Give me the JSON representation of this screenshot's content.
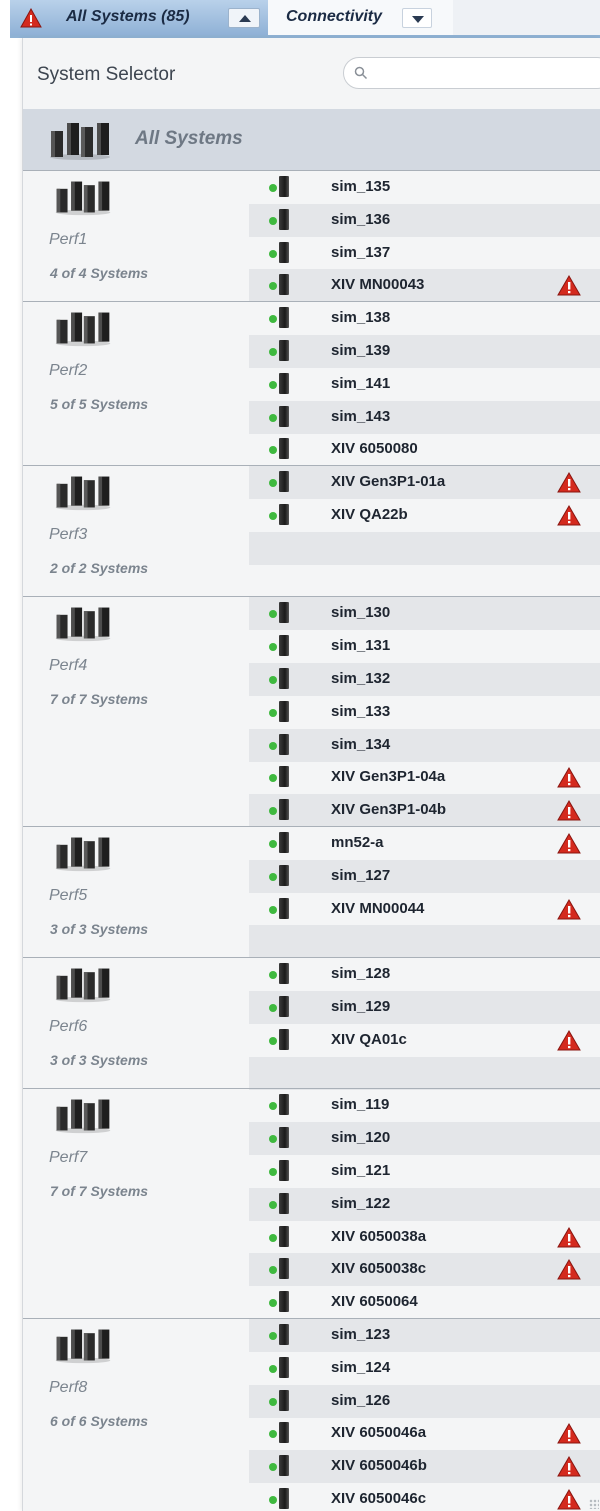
{
  "tabs": {
    "all_systems": {
      "label": "All Systems (85)",
      "alert_icon": "warning-icon",
      "toggle_icon": "chevron-up-icon"
    },
    "connectivity": {
      "label": "Connectivity",
      "toggle_icon": "chevron-down-icon"
    }
  },
  "selector": {
    "title": "System Selector",
    "search_placeholder": "",
    "all_systems_label": "All Systems"
  },
  "colors": {
    "status_online": "#3fb93f",
    "alert_red": "#d42a1e",
    "tab_active": "#a9c4e2",
    "group_label": "#7b848e"
  },
  "groups": [
    {
      "name": "Perf1",
      "count": "4  of 4 Systems",
      "rows": 4,
      "systems": [
        {
          "name": "sim_135",
          "alert": false
        },
        {
          "name": "sim_136",
          "alert": false
        },
        {
          "name": "sim_137",
          "alert": false
        },
        {
          "name": "XIV MN00043",
          "alert": true
        }
      ]
    },
    {
      "name": "Perf2",
      "count": "5  of 5 Systems",
      "rows": 5,
      "systems": [
        {
          "name": "sim_138",
          "alert": false
        },
        {
          "name": "sim_139",
          "alert": false
        },
        {
          "name": "sim_141",
          "alert": false
        },
        {
          "name": "sim_143",
          "alert": false
        },
        {
          "name": "XIV 6050080",
          "alert": false
        }
      ]
    },
    {
      "name": "Perf3",
      "count": "2  of 2 Systems",
      "rows": 4,
      "systems": [
        {
          "name": "XIV Gen3P1-01a",
          "alert": true
        },
        {
          "name": "XIV QA22b",
          "alert": true
        }
      ]
    },
    {
      "name": "Perf4",
      "count": "7  of 7 Systems",
      "rows": 7,
      "systems": [
        {
          "name": "sim_130",
          "alert": false
        },
        {
          "name": "sim_131",
          "alert": false
        },
        {
          "name": "sim_132",
          "alert": false
        },
        {
          "name": "sim_133",
          "alert": false
        },
        {
          "name": "sim_134",
          "alert": false
        },
        {
          "name": "XIV Gen3P1-04a",
          "alert": true
        },
        {
          "name": "XIV Gen3P1-04b",
          "alert": true
        }
      ]
    },
    {
      "name": "Perf5",
      "count": "3  of 3 Systems",
      "rows": 4,
      "systems": [
        {
          "name": "mn52-a",
          "alert": true
        },
        {
          "name": "sim_127",
          "alert": false
        },
        {
          "name": "XIV MN00044",
          "alert": true
        }
      ]
    },
    {
      "name": "Perf6",
      "count": "3  of 3 Systems",
      "rows": 4,
      "systems": [
        {
          "name": "sim_128",
          "alert": false
        },
        {
          "name": "sim_129",
          "alert": false
        },
        {
          "name": "XIV QA01c",
          "alert": true
        }
      ]
    },
    {
      "name": "Perf7",
      "count": "7  of 7 Systems",
      "rows": 7,
      "systems": [
        {
          "name": "sim_119",
          "alert": false
        },
        {
          "name": "sim_120",
          "alert": false
        },
        {
          "name": "sim_121",
          "alert": false
        },
        {
          "name": "sim_122",
          "alert": false
        },
        {
          "name": "XIV 6050038a",
          "alert": true
        },
        {
          "name": "XIV 6050038c",
          "alert": true
        },
        {
          "name": "XIV 6050064",
          "alert": false
        }
      ]
    },
    {
      "name": "Perf8",
      "count": "6  of 6 Systems",
      "rows": 6,
      "systems": [
        {
          "name": "sim_123",
          "alert": false
        },
        {
          "name": "sim_124",
          "alert": false
        },
        {
          "name": "sim_126",
          "alert": false
        },
        {
          "name": "XIV 6050046a",
          "alert": true
        },
        {
          "name": "XIV 6050046b",
          "alert": true
        },
        {
          "name": "XIV 6050046c",
          "alert": true
        }
      ]
    }
  ]
}
